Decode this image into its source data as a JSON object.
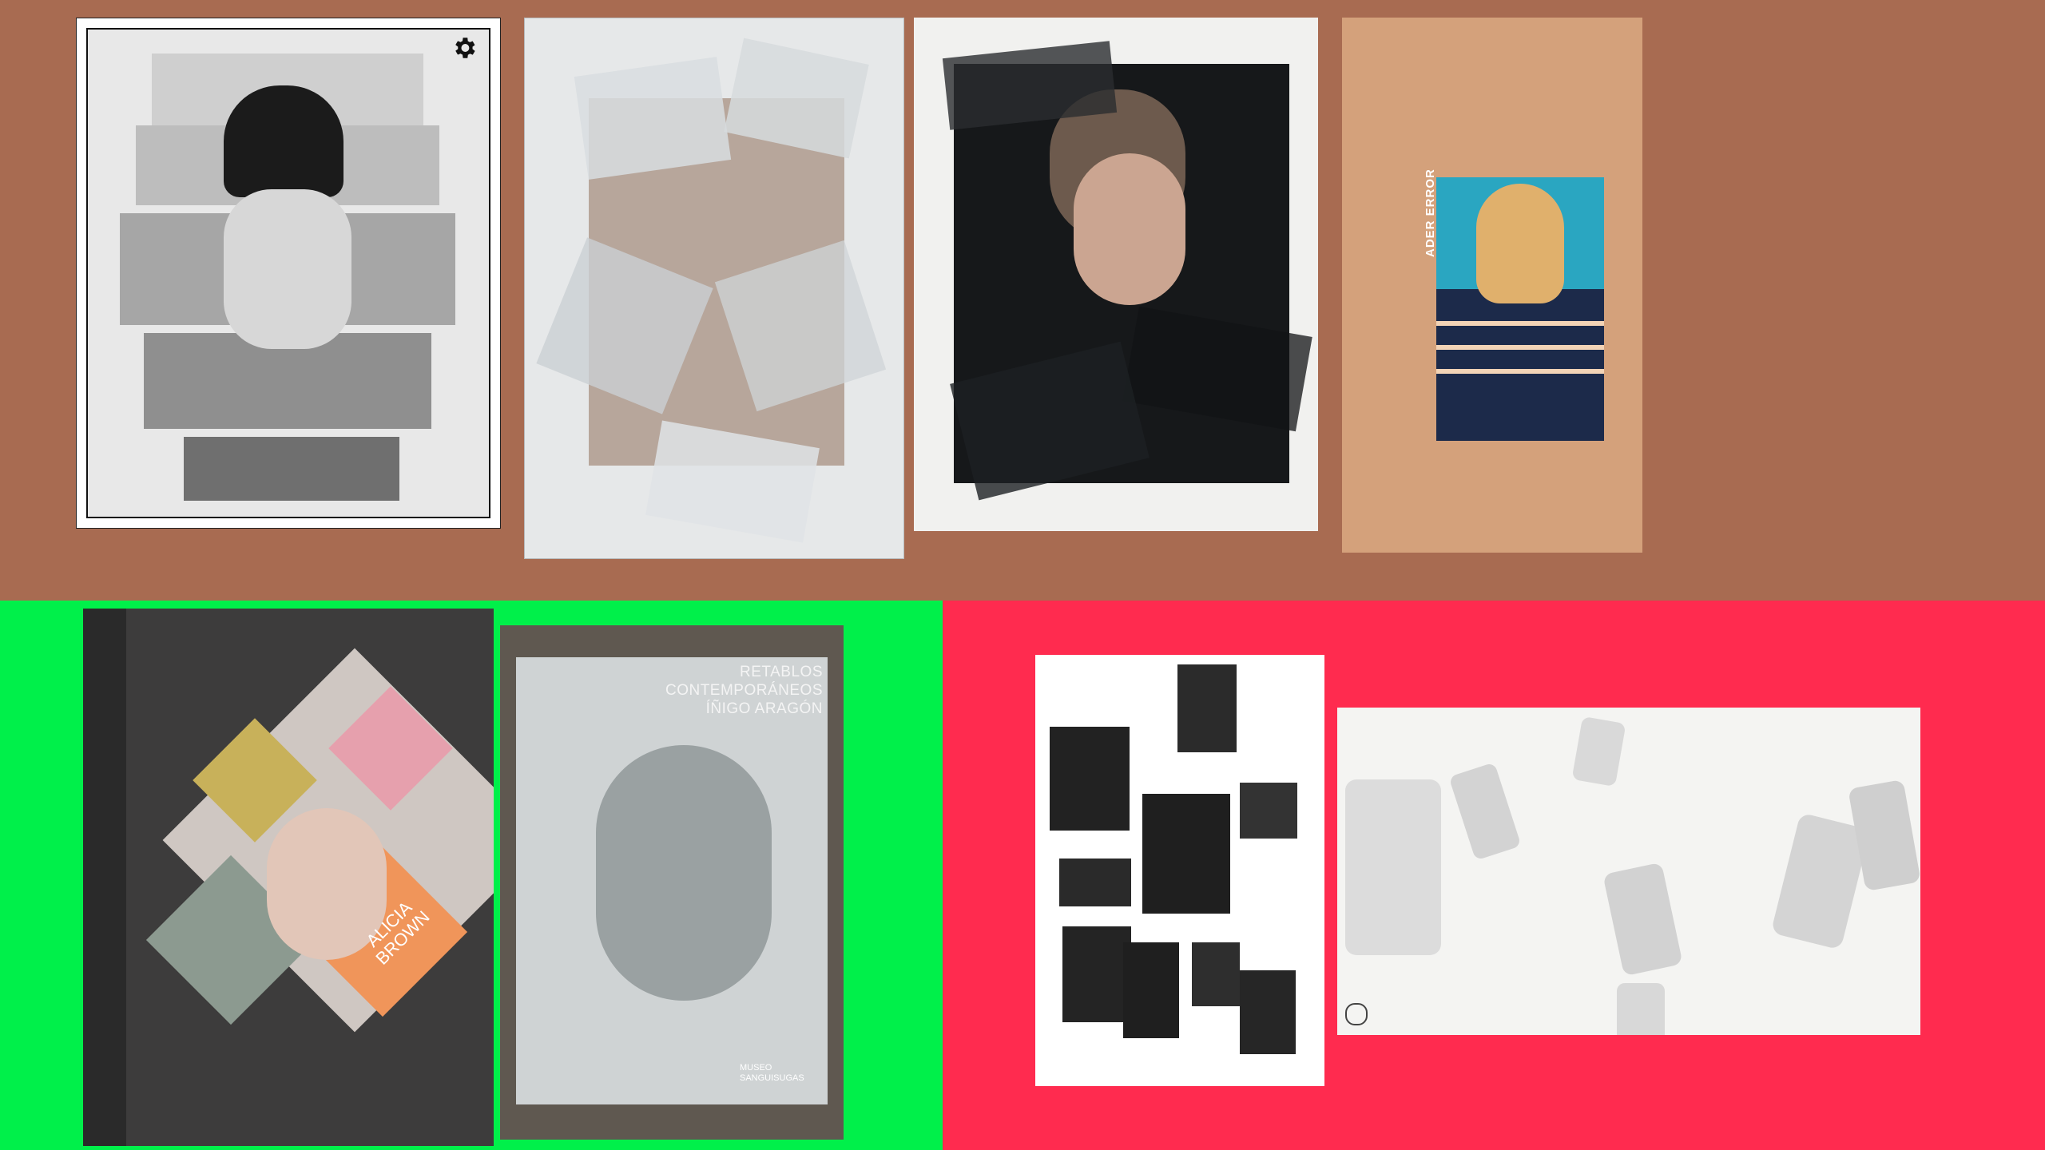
{
  "top_board": {
    "background": "#a86b51"
  },
  "green_board": {
    "background": "#00f04a"
  },
  "red_board": {
    "background": "#ff2b4f"
  },
  "card_1": {
    "settings_icon": "gear-icon"
  },
  "card_4": {
    "brand_text": "ADER ERROR"
  },
  "card_5": {
    "name_text": "ALICIA\nBROWN"
  },
  "card_6": {
    "title_text": "RETABLOS\nCONTEMPORÁNEOS\nÍÑIGO ARAGÓN",
    "logo_text": "MUSEO\nSANGUISUGAS"
  }
}
